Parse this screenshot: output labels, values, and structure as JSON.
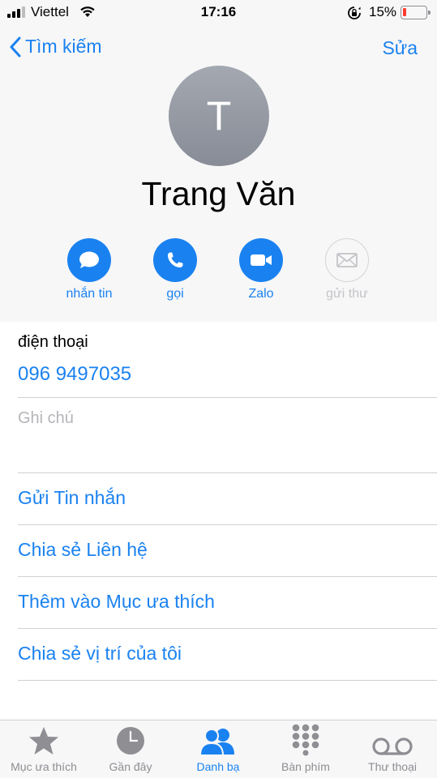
{
  "status_bar": {
    "carrier": "Viettel",
    "time": "17:16",
    "battery_percent": "15%",
    "battery_level": 0.15,
    "icons": [
      "signal-icon",
      "wifi-icon",
      "orientation-lock-icon",
      "battery-icon"
    ]
  },
  "nav": {
    "back_label": "Tìm kiếm",
    "edit_label": "Sửa"
  },
  "contact": {
    "initial": "T",
    "name": "Trang Văn"
  },
  "actions": [
    {
      "label": "nhắn tin",
      "icon": "message-icon",
      "enabled": true
    },
    {
      "label": "gọi",
      "icon": "phone-icon",
      "enabled": true
    },
    {
      "label": "Zalo",
      "icon": "video-icon",
      "enabled": true
    },
    {
      "label": "gửi thư",
      "icon": "mail-icon",
      "enabled": false
    }
  ],
  "phone": {
    "label": "điện thoại",
    "number": "096 9497035"
  },
  "notes": {
    "placeholder": "Ghi chú"
  },
  "links": {
    "send_message": "Gửi Tin nhắn",
    "share_contact": "Chia sẻ Liên hệ",
    "add_favorite": "Thêm vào Mục ưa thích",
    "share_location": "Chia sẻ vị trí của tôi"
  },
  "tabs": [
    {
      "label": "Mục ưa thích",
      "icon": "star-icon",
      "active": false
    },
    {
      "label": "Gần đây",
      "icon": "clock-icon",
      "active": false
    },
    {
      "label": "Danh bạ",
      "icon": "contacts-icon",
      "active": true
    },
    {
      "label": "Bàn phím",
      "icon": "keypad-icon",
      "active": false
    },
    {
      "label": "Thư thoại",
      "icon": "voicemail-icon",
      "active": false
    }
  ],
  "colors": {
    "accent": "#1a82f0",
    "battery_low": "#ff3b30",
    "header_bg": "#f7f7f8",
    "inactive_tab": "#8e8e93"
  }
}
